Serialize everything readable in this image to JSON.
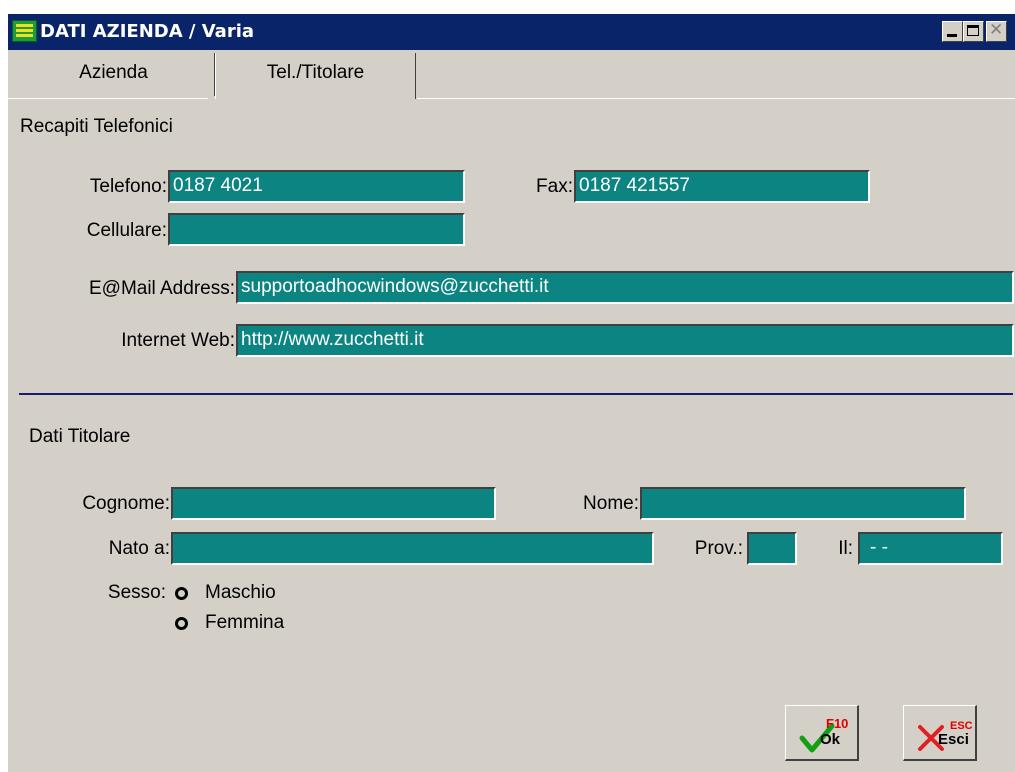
{
  "window": {
    "title": "DATI AZIENDA / Varia"
  },
  "tabs": [
    {
      "label": "Azienda"
    },
    {
      "label": "Tel./Titolare"
    }
  ],
  "recapiti": {
    "heading": "Recapiti Telefonici",
    "telefono": {
      "label": "Telefono:",
      "value": "0187 4021"
    },
    "fax": {
      "label": "Fax:",
      "value": "0187 421557"
    },
    "cellulare": {
      "label": "Cellulare:",
      "value": ""
    },
    "email": {
      "label": "E@Mail Address:",
      "value": "supportoadhocwindows@zucchetti.it"
    },
    "web": {
      "label": "Internet Web:",
      "value": "http://www.zucchetti.it"
    }
  },
  "titolare": {
    "heading": "Dati Titolare",
    "cognome": {
      "label": "Cognome:",
      "value": ""
    },
    "nome": {
      "label": "Nome:",
      "value": ""
    },
    "nato_a": {
      "label": "Nato a:",
      "value": ""
    },
    "prov": {
      "label": "Prov.:",
      "value": ""
    },
    "il": {
      "label": "Il:",
      "value": "- -"
    },
    "sesso": {
      "label": "Sesso:",
      "options": [
        "Maschio",
        "Femmina"
      ]
    }
  },
  "buttons": {
    "ok": {
      "key": "F10",
      "label": "Ok"
    },
    "esci": {
      "key": "ESC",
      "label": "Esci"
    }
  },
  "colors": {
    "field": "#0c8582",
    "title_bar": "#0a246a",
    "window": "#d4d0c8"
  }
}
